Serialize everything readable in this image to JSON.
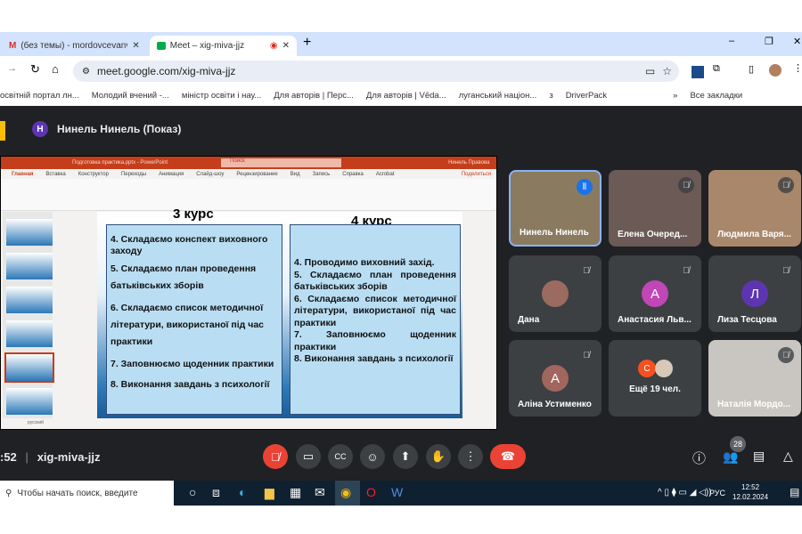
{
  "browser": {
    "tabs": [
      {
        "label": "(без темы) - mordovcevanv@g",
        "icon": "gmail-icon"
      },
      {
        "label": "Meet – xig-miva-jjz",
        "icon": "meet-icon",
        "recording": true
      }
    ],
    "url": "meet.google.com/xig-miva-jjz",
    "bookmarks": [
      "освітній портал лн...",
      "Молодий вчений -...",
      "міністр освіти і нау...",
      "Для авторів | Перс...",
      "Для авторів | Vēda...",
      "луганський націон...",
      "з",
      "DriverPack"
    ],
    "all_bookmarks": "Все закладки"
  },
  "meet": {
    "presenter": "Нинель Нинель (Показ)",
    "presenter_initial": "Н",
    "time": ":52",
    "meeting_code": "xig-miva-jjz",
    "participants_count": "28",
    "accent": "#ea4335"
  },
  "powerpoint": {
    "title": "Подготовка практика.pptx - PowerPoint",
    "search": "Поиск",
    "user": "Нинель Правова",
    "share": "Поделиться",
    "tabs": [
      "Главная",
      "Вставка",
      "Конструктор",
      "Переходы",
      "Анимация",
      "Слайд-шоу",
      "Рецензирование",
      "Вид",
      "Запись",
      "Справка",
      "Acrobat"
    ],
    "status_lang": "русский"
  },
  "slide": {
    "col3_title": "3 курс",
    "col4_title": "4 курс",
    "col3_items": [
      "4. Складаємо конспект виховного заходу",
      "5. Складаємо план проведення батьківських зборів",
      "6. Складаємо список методичної літератури, використаної під час практики",
      "7. Заповнюємо щоденник практики",
      "8. Виконання завдань з психології"
    ],
    "col4_items": [
      "4. Проводимо виховний захід.",
      "5. Складаємо план проведення батьківських зборів",
      "6. Складаємо список методичної літератури, використаної під час практики",
      "7. Заповнюємо щоденник практики",
      "8. Виконання завдань з психології"
    ]
  },
  "tiles": [
    {
      "name": "Нинель Нинель",
      "speaking": true,
      "bg": "#8a7a60"
    },
    {
      "name": "Елена Очеред...",
      "bg": "#6b5a55"
    },
    {
      "name": "Людмила Варя...",
      "bg": "#a9876a"
    },
    {
      "name": "Дана",
      "bg": "#3c4043",
      "avatar_color": "#9b6b60"
    },
    {
      "name": "Анастасия Льв...",
      "initial": "А",
      "avatar_color": "#c047b5"
    },
    {
      "name": "Лиза Тесцова",
      "initial": "Л",
      "avatar_color": "#5e35b1"
    },
    {
      "name": "Аліна Устименко",
      "initial": "А",
      "avatar_color": "#a1665e"
    },
    {
      "name": "Ещё 19 чел.",
      "initial": "С",
      "avatar_color": "#f4511e"
    },
    {
      "name": "Наталія Мордо...",
      "bg": "#c9c5c0"
    }
  ],
  "taskbar": {
    "search_placeholder": "Чтобы начать поиск, введите",
    "lang": "РУС",
    "time": "12:52",
    "date": "12.02.2024"
  }
}
